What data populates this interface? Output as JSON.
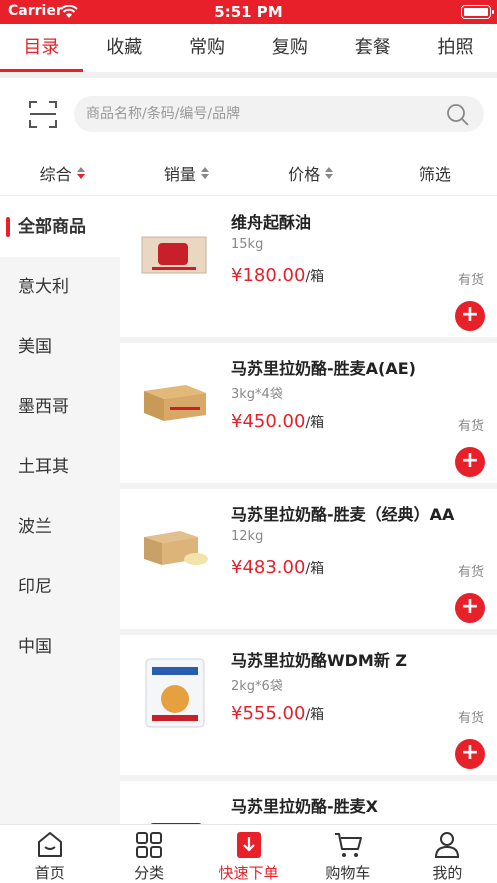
{
  "status": {
    "carrier": "Carrier",
    "time": "5:51 PM"
  },
  "tabs": [
    {
      "label": "目录",
      "active": true
    },
    {
      "label": "收藏"
    },
    {
      "label": "常购"
    },
    {
      "label": "复购"
    },
    {
      "label": "套餐"
    },
    {
      "label": "拍照"
    }
  ],
  "search": {
    "placeholder": "商品名称/条码/编号/品牌"
  },
  "sort": [
    {
      "label": "综合"
    },
    {
      "label": "销量"
    },
    {
      "label": "价格"
    },
    {
      "label": "筛选"
    }
  ],
  "sidebar": {
    "items": [
      {
        "label": "全部商品"
      },
      {
        "label": "意大利"
      },
      {
        "label": "美国"
      },
      {
        "label": "墨西哥"
      },
      {
        "label": "土耳其"
      },
      {
        "label": "波兰"
      },
      {
        "label": "印尼"
      },
      {
        "label": "中国"
      }
    ]
  },
  "products": [
    {
      "name": "维舟起酥油",
      "spec": "15kg",
      "price": "¥180.00",
      "unit": "/箱",
      "stock": "有货",
      "img": "box-label-icon"
    },
    {
      "name": "马苏里拉奶酪-胜麦A(AE)",
      "spec": "3kg*4袋",
      "price": "¥450.00",
      "unit": "/箱",
      "stock": "有货",
      "img": "carton-box-icon"
    },
    {
      "name": "马苏里拉奶酪-胜麦（经典）AA",
      "spec": "12kg",
      "price": "¥483.00",
      "unit": "/箱",
      "stock": "有货",
      "img": "carton-cheese-icon"
    },
    {
      "name": "马苏里拉奶酪WDM新 Z",
      "spec": "2kg*6袋",
      "price": "¥555.00",
      "unit": "/箱",
      "stock": "有货",
      "img": "cheese-bag-icon"
    },
    {
      "name": "马苏里拉奶酪-胜麦X",
      "spec": "",
      "price": "",
      "unit": "",
      "stock": "",
      "img": "blue-bag-icon"
    }
  ],
  "add_label": "+",
  "bottom_nav": [
    {
      "label": "首页",
      "icon": "home-icon"
    },
    {
      "label": "分类",
      "icon": "category-grid-icon"
    },
    {
      "label": "快速下单",
      "icon": "quick-order-icon",
      "active": true
    },
    {
      "label": "购物车",
      "icon": "cart-icon"
    },
    {
      "label": "我的",
      "icon": "user-icon"
    }
  ],
  "colors": {
    "accent": "#e8202a"
  }
}
